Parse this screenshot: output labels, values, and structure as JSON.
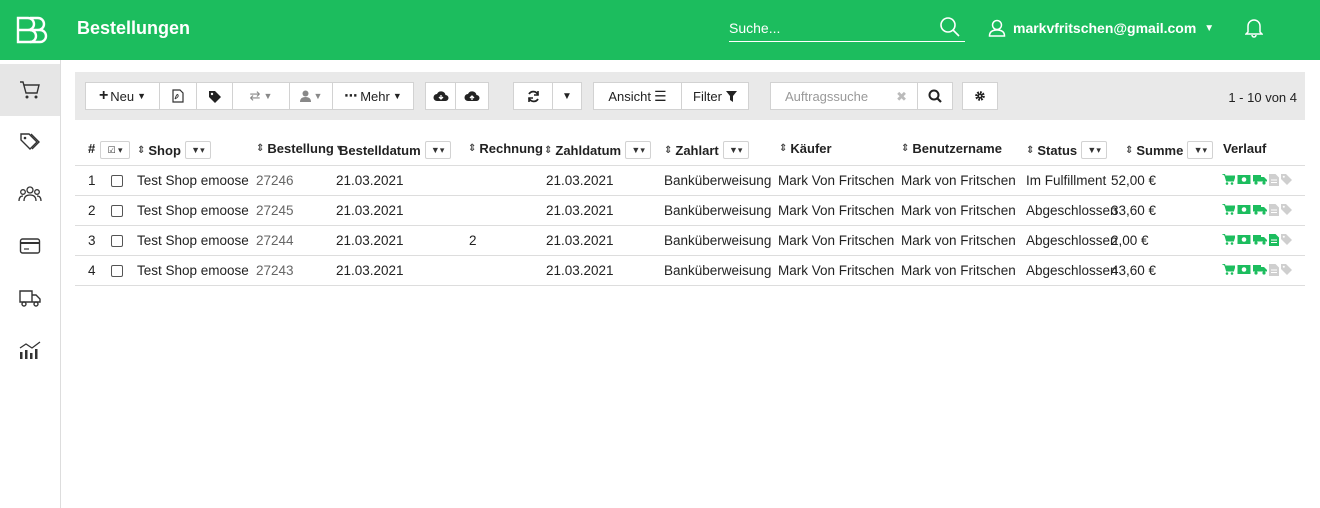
{
  "app": {
    "title": "Bestellungen",
    "brand_color": "#1cbd5e",
    "search_placeholder": "Suche...",
    "user_email": "markvfritschen@gmail.com"
  },
  "sidebar": {
    "items": [
      {
        "icon": "cart-icon",
        "active": true
      },
      {
        "icon": "tags-icon",
        "active": false
      },
      {
        "icon": "users-icon",
        "active": false
      },
      {
        "icon": "credit-card-icon",
        "active": false
      },
      {
        "icon": "truck-icon",
        "active": false
      },
      {
        "icon": "analytics-icon",
        "active": false
      }
    ]
  },
  "toolbar": {
    "new_label": "Neu",
    "more_label": "Mehr",
    "view_label": "Ansicht",
    "filter_label": "Filter",
    "order_search_placeholder": "Auftragssuche",
    "pagination": "1 - 10 von 4"
  },
  "table": {
    "headers": {
      "num": "#",
      "shop": "Shop",
      "order": "Bestellung",
      "order_date": "Bestelldatum",
      "invoice": "Rechnung",
      "payment_date": "Zahldatum",
      "payment_type": "Zahlart",
      "buyer": "Käufer",
      "username": "Benutzername",
      "status": "Status",
      "total": "Summe",
      "history": "Verlauf"
    },
    "rows": [
      {
        "num": "1",
        "shop": "Test Shop emoose",
        "order": "27246",
        "order_date": "21.03.2021",
        "invoice": "",
        "payment_date": "21.03.2021",
        "payment_type": "Banküberweisung",
        "buyer": "Mark Von Fritschen",
        "username": "Mark von Fritschen",
        "status": "Im Fulfillment",
        "total": "52,00 €",
        "invoice_done": false
      },
      {
        "num": "2",
        "shop": "Test Shop emoose",
        "order": "27245",
        "order_date": "21.03.2021",
        "invoice": "",
        "payment_date": "21.03.2021",
        "payment_type": "Banküberweisung",
        "buyer": "Mark Von Fritschen",
        "username": "Mark von Fritschen",
        "status": "Abgeschlossen",
        "total": "33,60 €",
        "invoice_done": false
      },
      {
        "num": "3",
        "shop": "Test Shop emoose",
        "order": "27244",
        "order_date": "21.03.2021",
        "invoice": "2",
        "payment_date": "21.03.2021",
        "payment_type": "Banküberweisung",
        "buyer": "Mark Von Fritschen",
        "username": "Mark von Fritschen",
        "status": "Abgeschlossen",
        "total": "2,00 €",
        "invoice_done": true
      },
      {
        "num": "4",
        "shop": "Test Shop emoose",
        "order": "27243",
        "order_date": "21.03.2021",
        "invoice": "",
        "payment_date": "21.03.2021",
        "payment_type": "Banküberweisung",
        "buyer": "Mark Von Fritschen",
        "username": "Mark von Fritschen",
        "status": "Abgeschlossen",
        "total": "43,60 €",
        "invoice_done": false
      }
    ]
  }
}
